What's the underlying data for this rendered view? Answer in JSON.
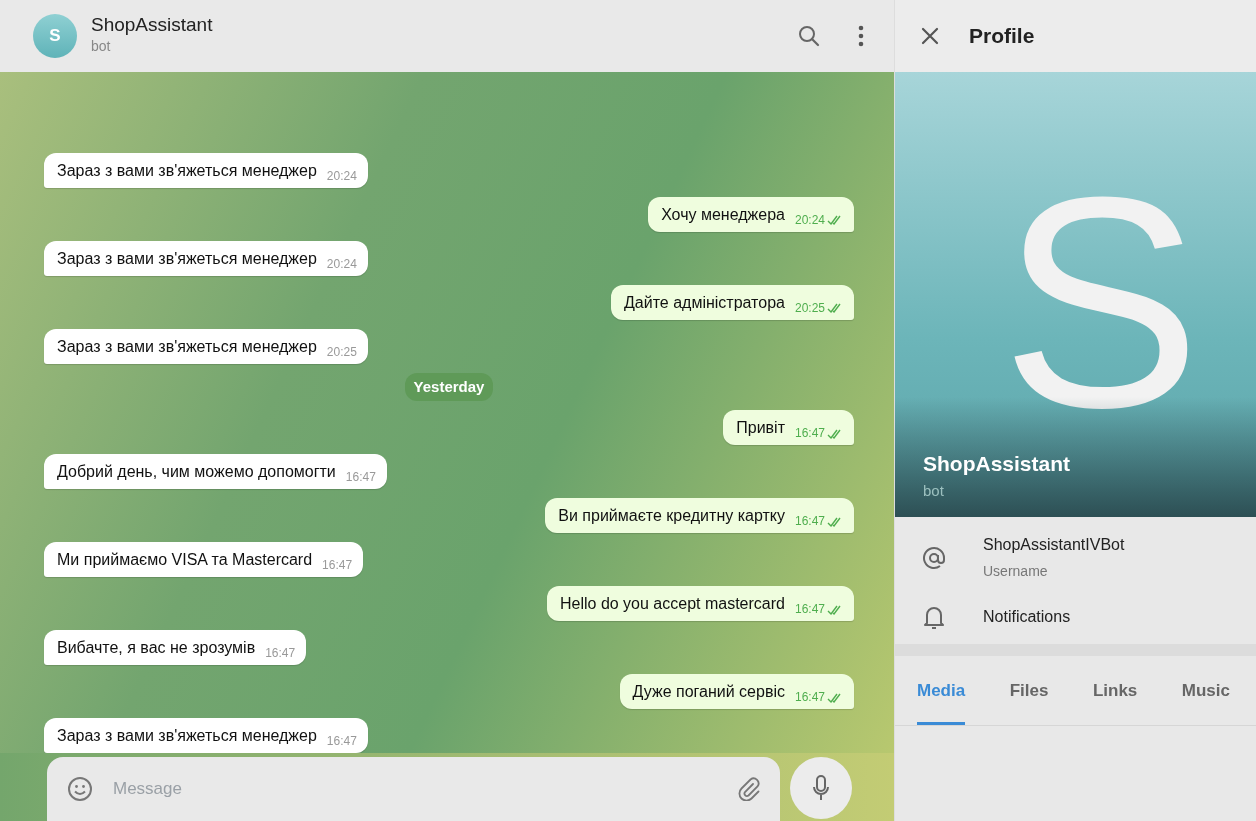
{
  "chat_header": {
    "avatar_letter": "S",
    "title": "ShopAssistant",
    "subtitle": "bot"
  },
  "messages": [
    {
      "kind": "incoming",
      "text": "Зараз з вами зв'яжеться менеджер",
      "time": "20:24"
    },
    {
      "kind": "outgoing",
      "text": "Хочу менеджера",
      "time": "20:24",
      "read": true
    },
    {
      "kind": "incoming",
      "text": "Зараз з вами зв'яжеться менеджер",
      "time": "20:24"
    },
    {
      "kind": "outgoing",
      "text": "Дайте адміністратора",
      "time": "20:25",
      "read": true
    },
    {
      "kind": "incoming",
      "text": "Зараз з вами зв'яжеться менеджер",
      "time": "20:25"
    },
    {
      "kind": "date",
      "text": "Yesterday"
    },
    {
      "kind": "outgoing",
      "text": "Привіт",
      "time": "16:47",
      "read": true
    },
    {
      "kind": "incoming",
      "text": "Добрий день, чим можемо допомогти",
      "time": "16:47"
    },
    {
      "kind": "outgoing",
      "text": "Ви приймаєте кредитну картку",
      "time": "16:47",
      "read": true
    },
    {
      "kind": "incoming",
      "text": "Ми приймаємо VISA та Mastercard",
      "time": "16:47"
    },
    {
      "kind": "outgoing",
      "text": "Hello do you accept mastercard",
      "time": "16:47",
      "read": true
    },
    {
      "kind": "incoming",
      "text": "Вибачте, я вас не зрозумів",
      "time": "16:47"
    },
    {
      "kind": "outgoing",
      "text": "Дуже поганий сервіс",
      "time": "16:47",
      "read": true
    },
    {
      "kind": "incoming",
      "text": "Зараз з вами зв'яжеться менеджер",
      "time": "16:47"
    }
  ],
  "composer": {
    "placeholder": "Message"
  },
  "profile": {
    "title": "Profile",
    "avatar_letter": "S",
    "name": "ShopAssistant",
    "subtitle": "bot",
    "info": [
      {
        "kind": "username",
        "value": "ShopAssistantIVBot",
        "label": "Username"
      },
      {
        "kind": "notifications",
        "value": "Notifications"
      }
    ],
    "tabs": [
      {
        "label": "Media",
        "selected": true
      },
      {
        "label": "Files",
        "selected": false
      },
      {
        "label": "Links",
        "selected": false
      },
      {
        "label": "Music",
        "selected": false
      }
    ]
  }
}
